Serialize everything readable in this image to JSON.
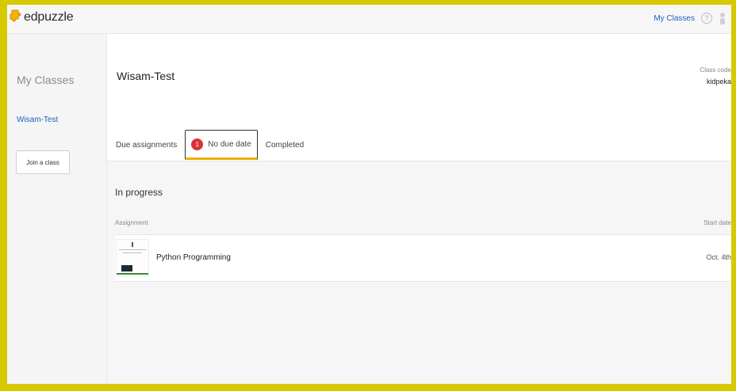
{
  "topbar": {
    "brand": "edpuzzle",
    "my_classes_link": "My Classes",
    "help_glyph": "?"
  },
  "sidebar": {
    "title": "My Classes",
    "classes": [
      {
        "label": "Wisam-Test"
      }
    ],
    "join_button": "Join a class"
  },
  "header": {
    "class_title": "Wisam-Test",
    "class_code_label": "Class code",
    "class_code": "kidpeka"
  },
  "tabs": [
    {
      "label": "Due assignments"
    },
    {
      "label": "No due date",
      "badge": "1",
      "active": true
    },
    {
      "label": "Completed"
    }
  ],
  "section": {
    "title": "In progress",
    "col_assignment": "Assignment",
    "col_start_date": "Start date",
    "rows": [
      {
        "name": "Python Programming",
        "start_date": "Oct. 4th"
      }
    ]
  },
  "icons": {
    "brand_logo": "puzzle-logo-icon",
    "help": "help-circle-icon",
    "avatar": "user-avatar-icon"
  },
  "colors": {
    "frame": "#d6c900",
    "link": "#1f5fbf",
    "badge": "#d9343b",
    "active_tab_underline": "#e8b000"
  }
}
